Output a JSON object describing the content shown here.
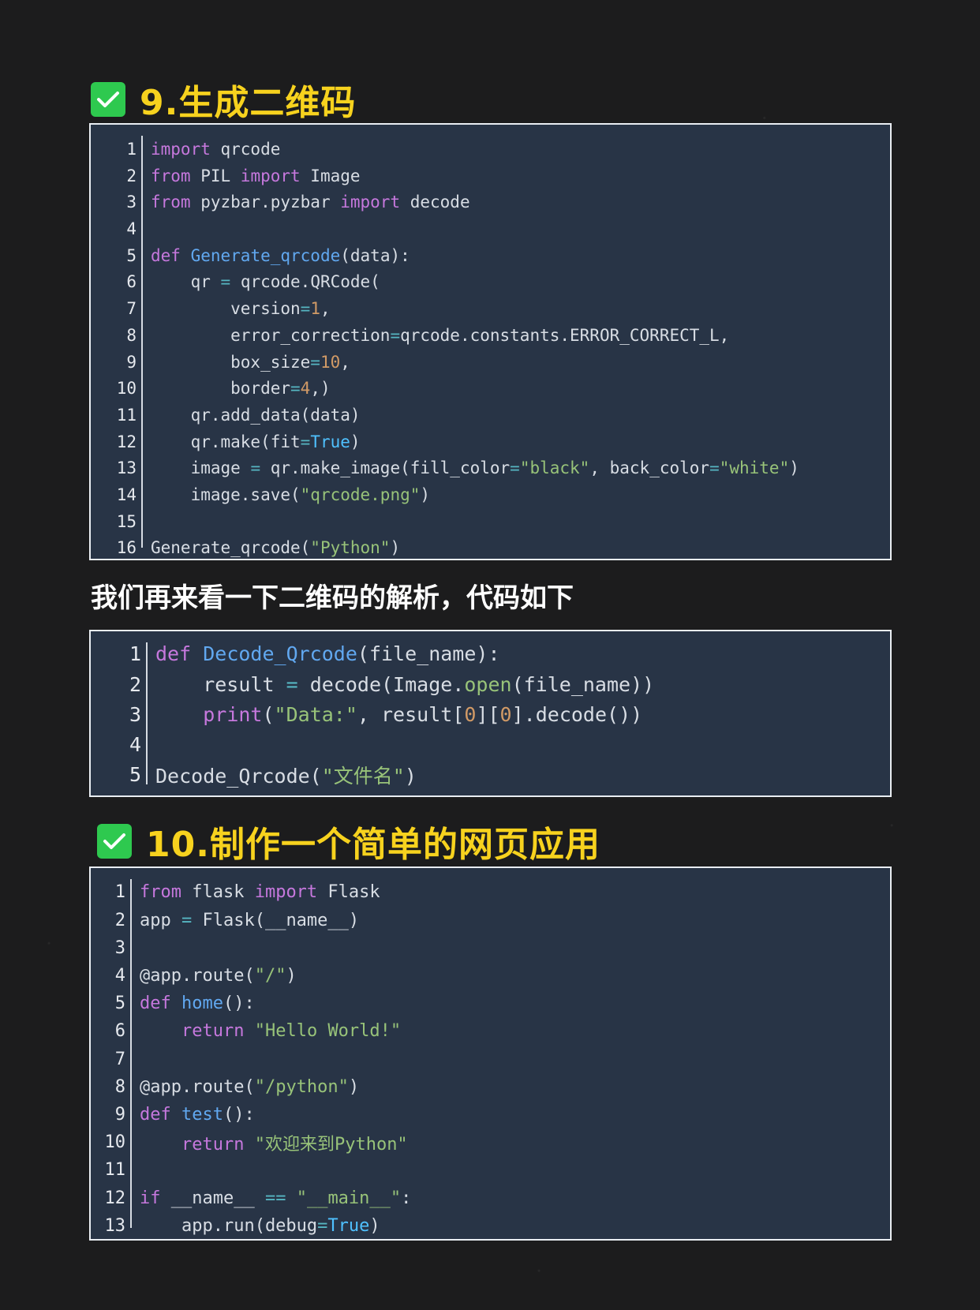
{
  "colors": {
    "background": "#1c1c1d",
    "heading": "#f7d21e",
    "check": "#2ec94f",
    "panel": "#283446",
    "keyword": "#c678dd",
    "function": "#61a8f0",
    "string": "#98c379",
    "operator": "#56b6c2",
    "number": "#d19a66",
    "builtin": "#4fc1ff"
  },
  "section1": {
    "title": "9.生成二维码",
    "icon": "check-icon",
    "lines": [
      {
        "n": "1",
        "t": [
          [
            "kw",
            "import"
          ],
          [
            "df",
            " qrcode"
          ]
        ]
      },
      {
        "n": "2",
        "t": [
          [
            "kw",
            "from"
          ],
          [
            "df",
            " PIL "
          ],
          [
            "kw",
            "import"
          ],
          [
            "df",
            " Image"
          ]
        ]
      },
      {
        "n": "3",
        "t": [
          [
            "kw",
            "from"
          ],
          [
            "df",
            " pyzbar.pyzbar "
          ],
          [
            "kw",
            "import"
          ],
          [
            "df",
            " decode"
          ]
        ]
      },
      {
        "n": "4",
        "t": []
      },
      {
        "n": "5",
        "t": [
          [
            "kw",
            "def"
          ],
          [
            "df",
            " "
          ],
          [
            "fn",
            "Generate_qrcode"
          ],
          [
            "df",
            "(data):"
          ]
        ]
      },
      {
        "n": "6",
        "t": [
          [
            "df",
            "    qr "
          ],
          [
            "op",
            "="
          ],
          [
            "df",
            " qrcode.QRCode("
          ]
        ]
      },
      {
        "n": "7",
        "t": [
          [
            "df",
            "        version"
          ],
          [
            "op",
            "="
          ],
          [
            "nb",
            "1"
          ],
          [
            "df",
            ","
          ]
        ]
      },
      {
        "n": "8",
        "t": [
          [
            "df",
            "        error_correction"
          ],
          [
            "op",
            "="
          ],
          [
            "df",
            "qrcode.constants.ERROR_CORRECT_L,"
          ]
        ]
      },
      {
        "n": "9",
        "t": [
          [
            "df",
            "        box_size"
          ],
          [
            "op",
            "="
          ],
          [
            "nb",
            "10"
          ],
          [
            "df",
            ","
          ]
        ]
      },
      {
        "n": "10",
        "t": [
          [
            "df",
            "        border"
          ],
          [
            "op",
            "="
          ],
          [
            "nb",
            "4"
          ],
          [
            "df",
            ",)"
          ]
        ]
      },
      {
        "n": "11",
        "t": [
          [
            "df",
            "    qr.add_data(data)"
          ]
        ]
      },
      {
        "n": "12",
        "t": [
          [
            "df",
            "    qr.make(fit"
          ],
          [
            "op",
            "="
          ],
          [
            "bl",
            "True"
          ],
          [
            "df",
            ")"
          ]
        ]
      },
      {
        "n": "13",
        "t": [
          [
            "df",
            "    image "
          ],
          [
            "op",
            "="
          ],
          [
            "df",
            " qr.make_image(fill_color"
          ],
          [
            "op",
            "="
          ],
          [
            "st",
            "\"black\""
          ],
          [
            "df",
            ", back_color"
          ],
          [
            "op",
            "="
          ],
          [
            "st",
            "\"white\""
          ],
          [
            "df",
            ")"
          ]
        ]
      },
      {
        "n": "14",
        "t": [
          [
            "df",
            "    image.save("
          ],
          [
            "st",
            "\"qrcode.png\""
          ],
          [
            "df",
            ")"
          ]
        ]
      },
      {
        "n": "15",
        "t": []
      },
      {
        "n": "16",
        "t": [
          [
            "df",
            "Generate_qrcode("
          ],
          [
            "st",
            "\"Python\""
          ],
          [
            "df",
            ")"
          ]
        ]
      }
    ]
  },
  "subtitle": "我们再来看一下二维码的解析，代码如下",
  "section2": {
    "lines": [
      {
        "n": "1",
        "t": [
          [
            "kw",
            "def"
          ],
          [
            "df",
            " "
          ],
          [
            "fn",
            "Decode_Qrcode"
          ],
          [
            "df",
            "(file_name):"
          ]
        ]
      },
      {
        "n": "2",
        "t": [
          [
            "df",
            "    result "
          ],
          [
            "op",
            "="
          ],
          [
            "df",
            " decode(Image."
          ],
          [
            "st",
            "open"
          ],
          [
            "df",
            "(file_name))"
          ]
        ]
      },
      {
        "n": "3",
        "t": [
          [
            "df",
            "    "
          ],
          [
            "kw",
            "print"
          ],
          [
            "df",
            "("
          ],
          [
            "st",
            "\"Data:\""
          ],
          [
            "df",
            ", result["
          ],
          [
            "nb",
            "0"
          ],
          [
            "df",
            "]["
          ],
          [
            "nb",
            "0"
          ],
          [
            "df",
            "].decode())"
          ]
        ]
      },
      {
        "n": "4",
        "t": []
      },
      {
        "n": "5",
        "t": [
          [
            "df",
            "Decode_Qrcode("
          ],
          [
            "st",
            "\"文件名\""
          ],
          [
            "df",
            ")"
          ]
        ]
      }
    ]
  },
  "section3": {
    "title": "10.制作一个简单的网页应用",
    "icon": "check-icon",
    "lines": [
      {
        "n": "1",
        "t": [
          [
            "kw",
            "from"
          ],
          [
            "df",
            " flask "
          ],
          [
            "kw",
            "import"
          ],
          [
            "df",
            " Flask"
          ]
        ]
      },
      {
        "n": "2",
        "t": [
          [
            "df",
            "app "
          ],
          [
            "op",
            "="
          ],
          [
            "df",
            " Flask(__name__)"
          ]
        ]
      },
      {
        "n": "3",
        "t": []
      },
      {
        "n": "4",
        "t": [
          [
            "df",
            "@app.route("
          ],
          [
            "st",
            "\"/\""
          ],
          [
            "df",
            ")"
          ]
        ]
      },
      {
        "n": "5",
        "t": [
          [
            "kw",
            "def"
          ],
          [
            "df",
            " "
          ],
          [
            "fn",
            "home"
          ],
          [
            "df",
            "():"
          ]
        ]
      },
      {
        "n": "6",
        "t": [
          [
            "df",
            "    "
          ],
          [
            "kw",
            "return"
          ],
          [
            "df",
            " "
          ],
          [
            "st",
            "\"Hello World!\""
          ]
        ]
      },
      {
        "n": "7",
        "t": []
      },
      {
        "n": "8",
        "t": [
          [
            "df",
            "@app.route("
          ],
          [
            "st",
            "\"/python\""
          ],
          [
            "df",
            ")"
          ]
        ]
      },
      {
        "n": "9",
        "t": [
          [
            "kw",
            "def"
          ],
          [
            "df",
            " "
          ],
          [
            "fn",
            "test"
          ],
          [
            "df",
            "():"
          ]
        ]
      },
      {
        "n": "10",
        "t": [
          [
            "df",
            "    "
          ],
          [
            "kw",
            "return"
          ],
          [
            "df",
            " "
          ],
          [
            "st",
            "\"欢迎来到Python\""
          ]
        ]
      },
      {
        "n": "11",
        "t": []
      },
      {
        "n": "12",
        "t": [
          [
            "kw",
            "if"
          ],
          [
            "df",
            " __name__ "
          ],
          [
            "op",
            "=="
          ],
          [
            "df",
            " "
          ],
          [
            "st",
            "\"__main__\""
          ],
          [
            "df",
            ":"
          ]
        ]
      },
      {
        "n": "13",
        "t": [
          [
            "df",
            "    app.run(debug"
          ],
          [
            "op",
            "="
          ],
          [
            "bl",
            "True"
          ],
          [
            "df",
            ")"
          ]
        ]
      }
    ]
  }
}
